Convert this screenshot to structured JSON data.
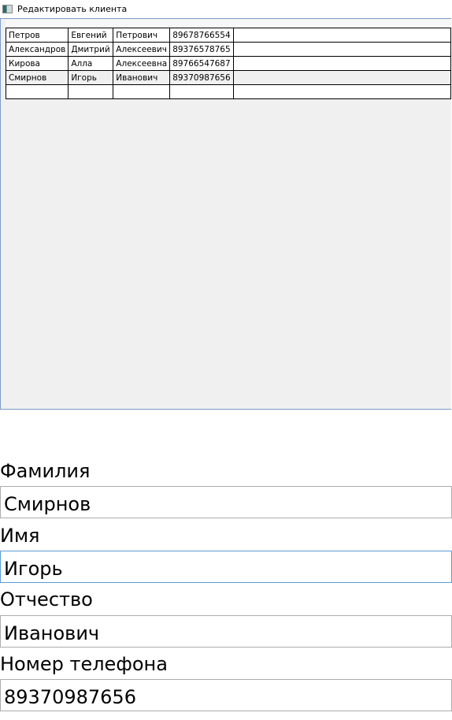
{
  "window": {
    "title": "Редактировать клиента"
  },
  "grid": {
    "rows": [
      [
        "Петров",
        "Евгений",
        "Петрович",
        "89678766554"
      ],
      [
        "Александров",
        "Дмитрий",
        "Алексеевич",
        "89376578765"
      ],
      [
        "Кирова",
        "Алла",
        "Алексеевна",
        "89766547687"
      ],
      [
        "Смирнов",
        "Игорь",
        "Иванович",
        "89370987656"
      ]
    ],
    "selected_row": 3
  },
  "form": {
    "surname_label": "Фамилия",
    "surname_value": "Смирнов",
    "name_label": "Имя",
    "name_value": "Игорь",
    "patronymic_label": "Отчество",
    "patronymic_value": "Иванович",
    "phone_label": "Номер телефона",
    "phone_value": "89370987656"
  }
}
